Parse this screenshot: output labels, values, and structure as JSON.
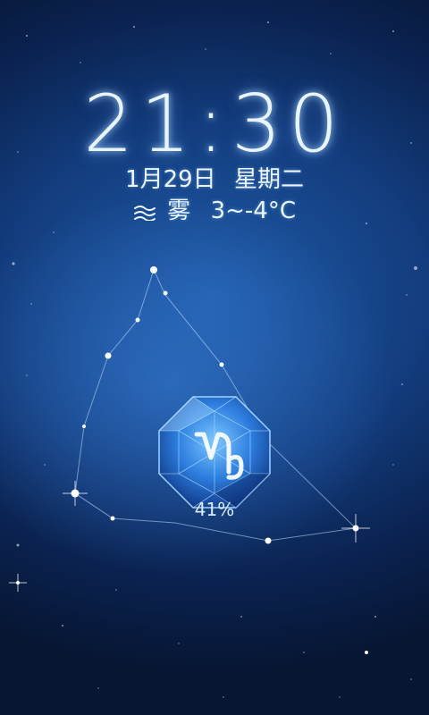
{
  "clock": {
    "time": "21:30"
  },
  "date": {
    "month_day": "1月29日",
    "weekday": "星期二"
  },
  "weather": {
    "icon": "fog-icon",
    "condition": "雾",
    "temperature": "3~-4°C"
  },
  "unlock": {
    "icon": "capricorn-zodiac-gem-icon",
    "battery_percent": "41%"
  },
  "colors": {
    "accent": "#4aa3ff",
    "background_top": "#071633",
    "background_center": "#1f5aa8"
  }
}
